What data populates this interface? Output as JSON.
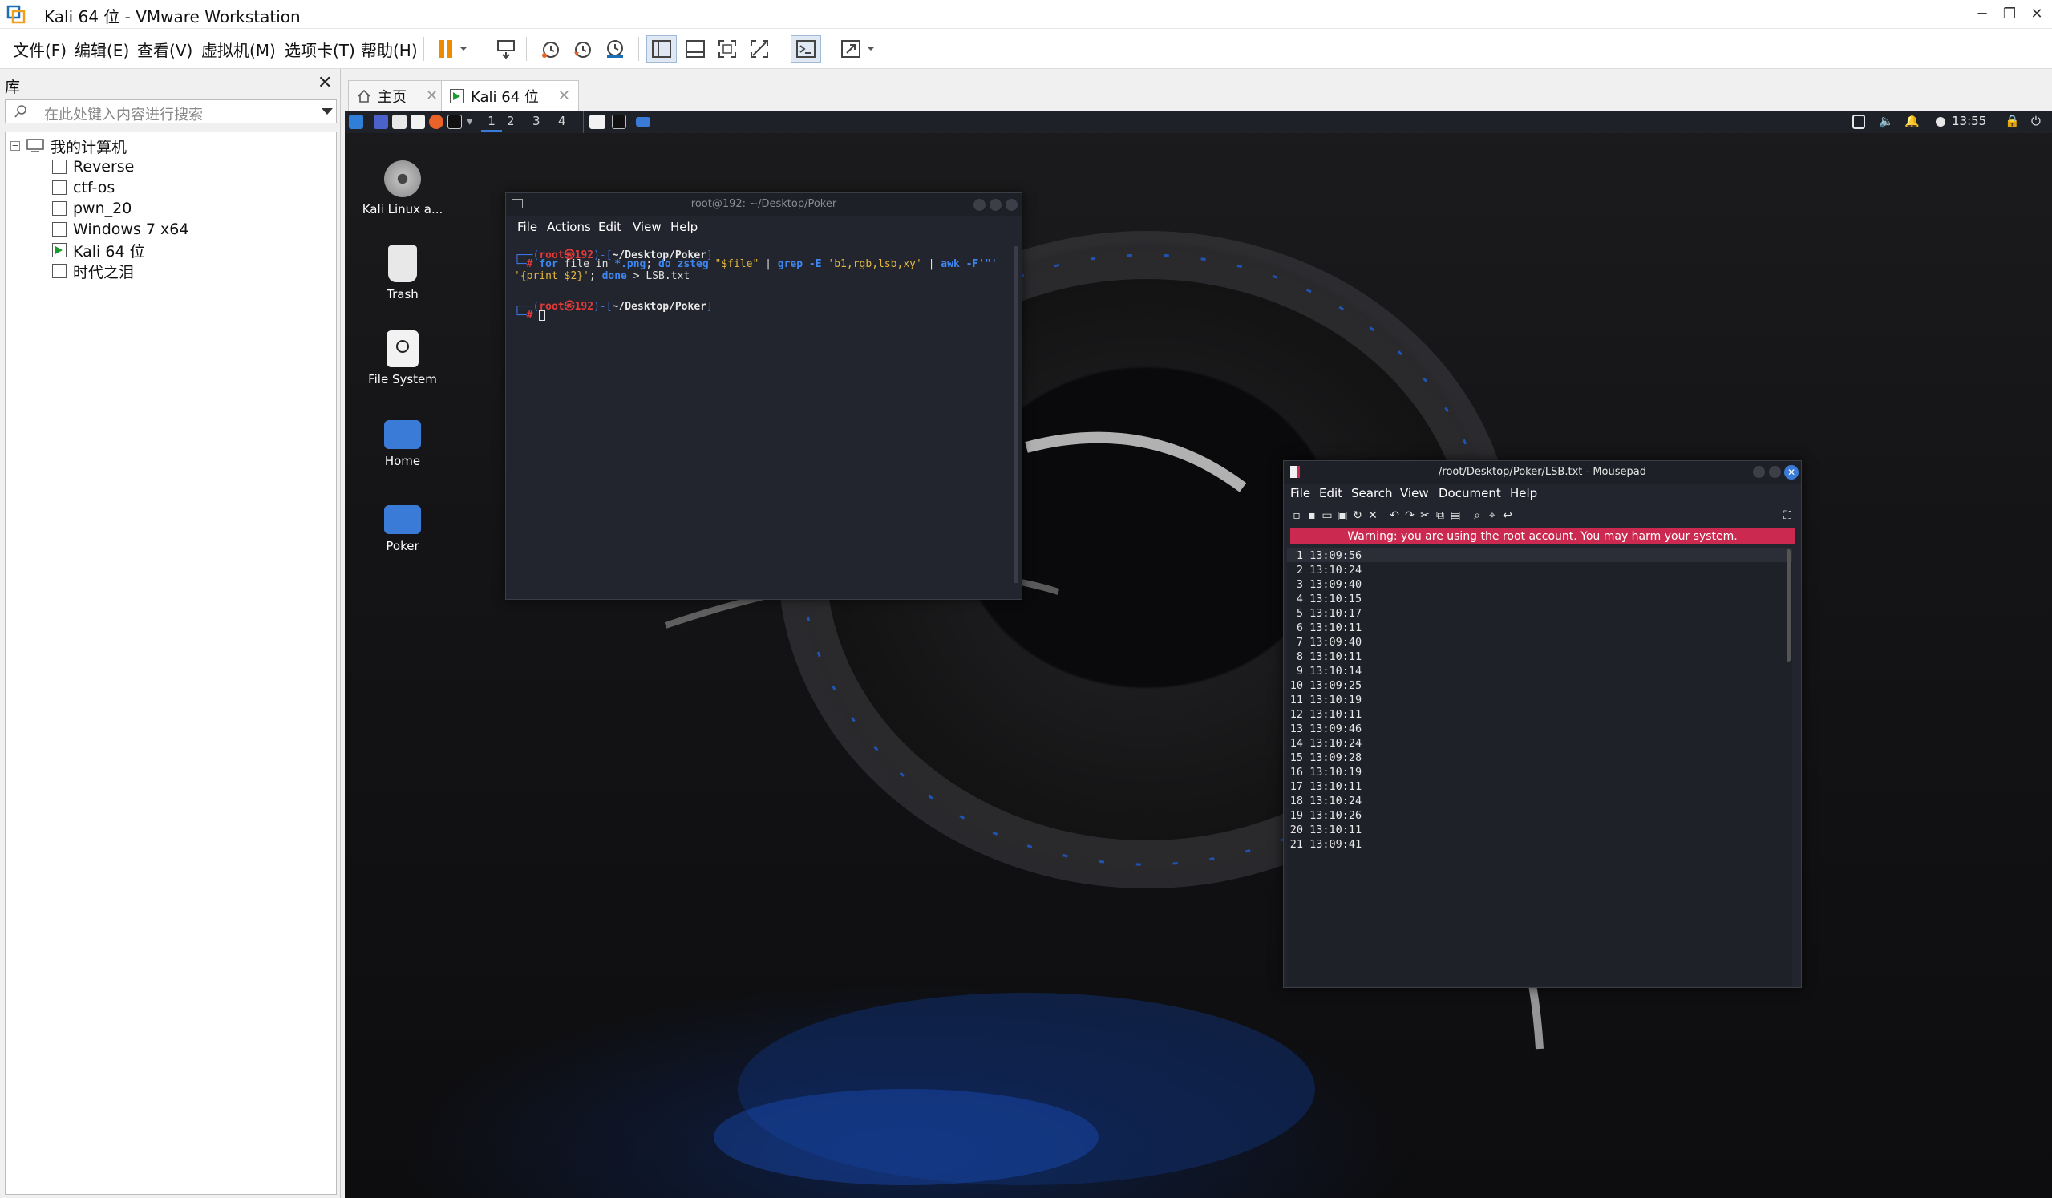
{
  "window": {
    "title": "Kali 64 位 - VMware Workstation"
  },
  "menubar": {
    "items": [
      "文件(F)",
      "编辑(E)",
      "查看(V)",
      "虚拟机(M)",
      "选项卡(T)",
      "帮助(H)"
    ]
  },
  "library": {
    "title": "库",
    "search_placeholder": "在此处键入内容进行搜索",
    "root": "我的计算机",
    "vms": [
      "Reverse",
      "ctf-os",
      "pwn_20",
      "Windows 7 x64",
      "Kali 64 位",
      "时代之泪"
    ],
    "running_vm_index": 4
  },
  "tabs": [
    {
      "label": "主页",
      "active": false
    },
    {
      "label": "Kali 64 位",
      "active": true
    }
  ],
  "guest": {
    "panel": {
      "workspaces": [
        "1",
        "2",
        "3",
        "4"
      ],
      "clock": "13:55"
    },
    "desktop_icons": [
      {
        "label": "Kali Linux a...",
        "icon": "disc-icon"
      },
      {
        "label": "Trash",
        "icon": "trash-icon"
      },
      {
        "label": "File System",
        "icon": "drive-icon"
      },
      {
        "label": "Home",
        "icon": "home-folder-icon"
      },
      {
        "label": "Poker",
        "icon": "folder-icon"
      }
    ],
    "terminal": {
      "title": "root@192: ~/Desktop/Poker",
      "menu": [
        "File",
        "Actions",
        "Edit",
        "View",
        "Help"
      ],
      "prompt_user": "root㉿192",
      "prompt_path": "~/Desktop/Poker",
      "cmd_part1": "for",
      "cmd_part2": " file in ",
      "cmd_part3": "*.png",
      "cmd_part4": "; ",
      "cmd_part5": "do",
      "cmd_part6": " zsteg ",
      "cmd_part7": "\"$file\"",
      "cmd_part8": " | ",
      "cmd_part9": "grep -E",
      "cmd_part10": " 'b1,rgb,lsb,xy'",
      "cmd_part11": " | ",
      "cmd_part12": "awk -F'\"'",
      "cmd_line2a": "'{print $2}'",
      "cmd_line2b": "; ",
      "cmd_line2c": "done",
      "cmd_line2d": " > LSB.txt",
      "prompt_symbol": "#"
    },
    "mousepad": {
      "title": "/root/Desktop/Poker/LSB.txt - Mousepad",
      "menu": [
        "File",
        "Edit",
        "Search",
        "View",
        "Document",
        "Help"
      ],
      "warning": "Warning: you are using the root account. You may harm your system.",
      "lines": [
        "13:09:56",
        "13:10:24",
        "13:09:40",
        "13:10:15",
        "13:10:17",
        "13:10:11",
        "13:09:40",
        "13:10:11",
        "13:10:14",
        "13:09:25",
        "13:10:19",
        "13:10:11",
        "13:09:46",
        "13:10:24",
        "13:09:28",
        "13:10:19",
        "13:10:11",
        "13:10:24",
        "13:10:26",
        "13:10:11",
        "13:09:41"
      ]
    }
  },
  "colors": {
    "warning_bg": "#cc2950",
    "prompt_red": "#e03a3a",
    "prompt_blue": "#3b74e2",
    "vm_running": "#1a9c2e"
  }
}
